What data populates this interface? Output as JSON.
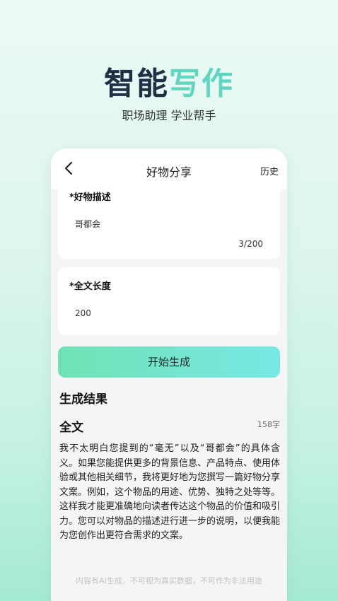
{
  "hero": {
    "title_part1": "智能",
    "title_part2": "写作",
    "subtitle": "职场助理 学业帮手"
  },
  "nav": {
    "title": "好物分享",
    "history_label": "历史"
  },
  "form": {
    "description_label": "*好物描述",
    "description_value": "哥都会",
    "description_count": "3/200",
    "length_label": "*全文长度",
    "length_value": "200"
  },
  "generate_button": "开始生成",
  "result": {
    "section_title": "生成结果",
    "full_title": "全文",
    "char_count": "158字",
    "text": "我不太明白您提到的“毫无”以及“哥都会”的具体含义。如果您能提供更多的背景信息、产品特点、使用体验或其他相关细节，我将更好地为您撰写一篇好物分享文案。例如，这个物品的用途、优势、独特之处等等。这样我才能更准确地向读者传达这个物品的价值和吸引力。您可以对物品的描述进行进一步的说明，以便我能为您创作出更符合需求的文案。"
  },
  "footer_note": "内容有AI生成，不可视为真实数据，不可作为非法用途",
  "colors": {
    "title_dark": "#1f2f45",
    "title_accent": "#5fd6c2",
    "button_start": "#6fe2b4",
    "button_end": "#78e8e4"
  }
}
